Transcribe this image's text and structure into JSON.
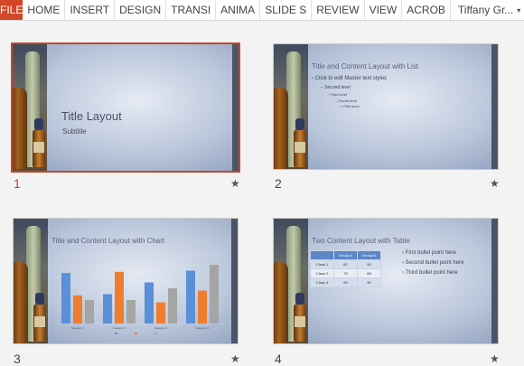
{
  "ribbon": {
    "file_label": "FILE",
    "tabs": [
      "HOME",
      "INSERT",
      "DESIGN",
      "TRANSI",
      "ANIMA",
      "SLIDE S",
      "REVIEW",
      "VIEW",
      "ACROB"
    ],
    "user_name": "Tiffany Gr..."
  },
  "slides": [
    {
      "number": "1",
      "title": "Title Layout",
      "subtitle": "Subtitle"
    },
    {
      "number": "2",
      "title": "Title and Content Layout with List",
      "bullets": [
        "Click to edit Master text styles",
        "Second level",
        "Third level",
        "Fourth level",
        "Fifth level"
      ]
    },
    {
      "number": "3",
      "title": "Title and Content Layout with Chart"
    },
    {
      "number": "4",
      "title": "Two Content Layout with Table",
      "table_header": [
        "",
        "Group A",
        "Group B"
      ],
      "table_rows": [
        [
          "Class 1",
          "82",
          "95"
        ],
        [
          "Class 2",
          "76",
          "88"
        ],
        [
          "Class 3",
          "84",
          "90"
        ]
      ],
      "bullets": [
        "First bullet point here",
        "Second bullet point here",
        "Third bullet point here"
      ]
    }
  ],
  "star_glyph": "★",
  "colors": {
    "accent": "#c8462a",
    "file_tab": "#d24726"
  },
  "chart_data": {
    "type": "bar",
    "title": "Title and Content Layout with Chart",
    "categories": [
      "Category 1",
      "Category 2",
      "Category 3",
      "Category 4"
    ],
    "series": [
      {
        "color": "#5b8fd8",
        "values": [
          4.3,
          2.5,
          3.5,
          4.5
        ]
      },
      {
        "color": "#f07c2e",
        "values": [
          2.4,
          4.4,
          1.8,
          2.8
        ]
      },
      {
        "color": "#a5a5a5",
        "values": [
          2.0,
          2.0,
          3.0,
          5.0
        ]
      }
    ],
    "ylim": [
      0,
      6
    ],
    "grid": true
  }
}
